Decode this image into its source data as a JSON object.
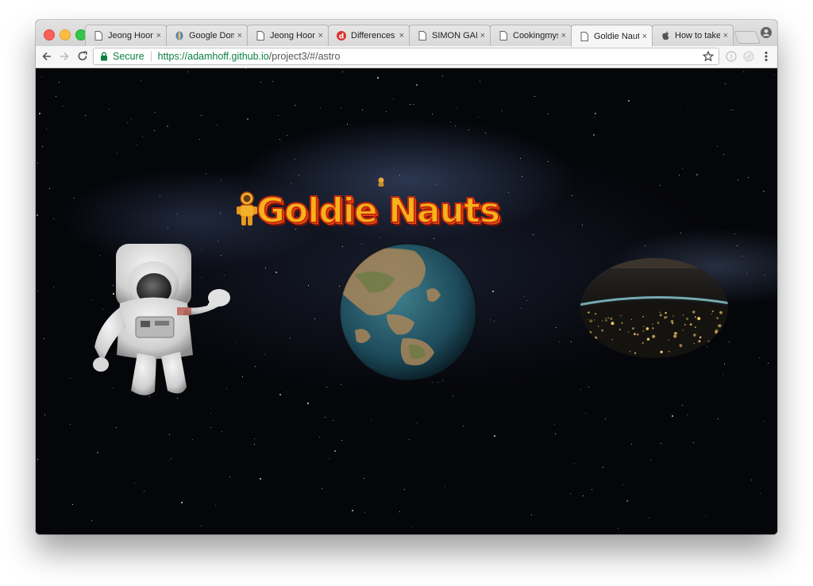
{
  "browser": {
    "tabs": [
      {
        "title": "Jeong Hoon",
        "icon": "page-icon",
        "active": false
      },
      {
        "title": "Google Dom",
        "icon": "google-domains-icon",
        "active": false
      },
      {
        "title": "Jeong Hoon",
        "icon": "page-icon",
        "active": false
      },
      {
        "title": "Differences b",
        "icon": "d-logo-icon",
        "active": false
      },
      {
        "title": "SIMON GAM",
        "icon": "page-icon",
        "active": false
      },
      {
        "title": "Cookingmyse",
        "icon": "page-icon",
        "active": false
      },
      {
        "title": "Goldie Nauts",
        "icon": "page-icon",
        "active": true
      },
      {
        "title": "How to take",
        "icon": "apple-icon",
        "active": false
      }
    ],
    "close_glyph": "×",
    "address": {
      "security_label": "Secure",
      "url_host": "https://adamhoff.github.io",
      "url_path": "/project3/#/astro"
    }
  },
  "page": {
    "logo_text": "Goldie Nauts",
    "images": [
      "astronaut-image",
      "earth-globe-image",
      "earth-at-night-image"
    ]
  },
  "colors": {
    "logo_fill": "#f6b21a",
    "logo_outline": "#c8260f",
    "secure_green": "#0b8043",
    "space_bg": "#05060a"
  }
}
